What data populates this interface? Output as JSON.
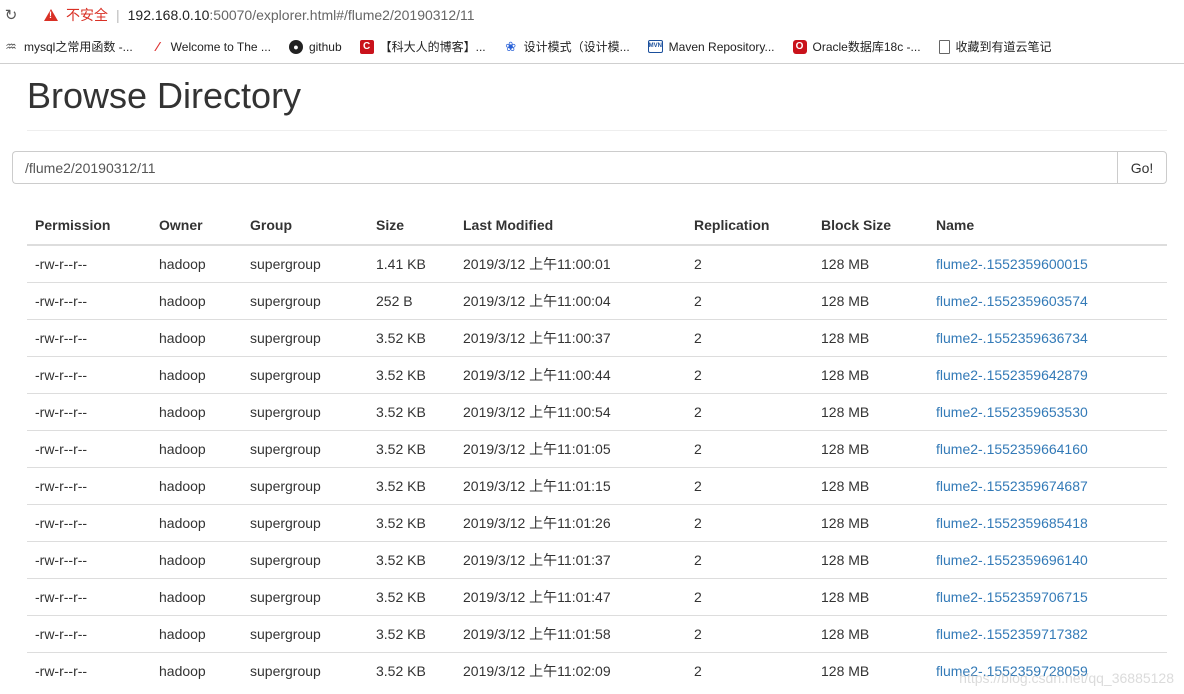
{
  "browser": {
    "security_label": "不安全",
    "url_host": "192.168.0.10",
    "url_rest": ":50070/explorer.html#/flume2/20190312/11",
    "bookmarks": [
      {
        "label": "mysql之常用函数 -...",
        "icon": "mysql-icon"
      },
      {
        "label": "Welcome to The ...",
        "icon": "feather-icon"
      },
      {
        "label": "github",
        "icon": "github-icon"
      },
      {
        "label": "【科大人的博客】...",
        "icon": "csdn-icon"
      },
      {
        "label": "设计模式（设计模...",
        "icon": "baidu-icon"
      },
      {
        "label": "Maven Repository...",
        "icon": "mvn-icon"
      },
      {
        "label": "Oracle数据库18c -...",
        "icon": "oracle-icon"
      },
      {
        "label": "收藏到有道云笔记",
        "icon": "page-icon"
      }
    ]
  },
  "page": {
    "title": "Browse Directory",
    "path_value": "/flume2/20190312/11",
    "go_label": "Go!"
  },
  "table": {
    "headers": [
      "Permission",
      "Owner",
      "Group",
      "Size",
      "Last Modified",
      "Replication",
      "Block Size",
      "Name"
    ],
    "rows": [
      [
        "-rw-r--r--",
        "hadoop",
        "supergroup",
        "1.41 KB",
        "2019/3/12 上午11:00:01",
        "2",
        "128 MB",
        "flume2-.1552359600015"
      ],
      [
        "-rw-r--r--",
        "hadoop",
        "supergroup",
        "252 B",
        "2019/3/12 上午11:00:04",
        "2",
        "128 MB",
        "flume2-.1552359603574"
      ],
      [
        "-rw-r--r--",
        "hadoop",
        "supergroup",
        "3.52 KB",
        "2019/3/12 上午11:00:37",
        "2",
        "128 MB",
        "flume2-.1552359636734"
      ],
      [
        "-rw-r--r--",
        "hadoop",
        "supergroup",
        "3.52 KB",
        "2019/3/12 上午11:00:44",
        "2",
        "128 MB",
        "flume2-.1552359642879"
      ],
      [
        "-rw-r--r--",
        "hadoop",
        "supergroup",
        "3.52 KB",
        "2019/3/12 上午11:00:54",
        "2",
        "128 MB",
        "flume2-.1552359653530"
      ],
      [
        "-rw-r--r--",
        "hadoop",
        "supergroup",
        "3.52 KB",
        "2019/3/12 上午11:01:05",
        "2",
        "128 MB",
        "flume2-.1552359664160"
      ],
      [
        "-rw-r--r--",
        "hadoop",
        "supergroup",
        "3.52 KB",
        "2019/3/12 上午11:01:15",
        "2",
        "128 MB",
        "flume2-.1552359674687"
      ],
      [
        "-rw-r--r--",
        "hadoop",
        "supergroup",
        "3.52 KB",
        "2019/3/12 上午11:01:26",
        "2",
        "128 MB",
        "flume2-.1552359685418"
      ],
      [
        "-rw-r--r--",
        "hadoop",
        "supergroup",
        "3.52 KB",
        "2019/3/12 上午11:01:37",
        "2",
        "128 MB",
        "flume2-.1552359696140"
      ],
      [
        "-rw-r--r--",
        "hadoop",
        "supergroup",
        "3.52 KB",
        "2019/3/12 上午11:01:47",
        "2",
        "128 MB",
        "flume2-.1552359706715"
      ],
      [
        "-rw-r--r--",
        "hadoop",
        "supergroup",
        "3.52 KB",
        "2019/3/12 上午11:01:58",
        "2",
        "128 MB",
        "flume2-.1552359717382"
      ],
      [
        "-rw-r--r--",
        "hadoop",
        "supergroup",
        "3.52 KB",
        "2019/3/12 上午11:02:09",
        "2",
        "128 MB",
        "flume2-.1552359728059"
      ]
    ]
  },
  "watermark": "https://blog.csdn.net/qq_36885128",
  "colors": {
    "link": "#337ab7",
    "insecure": "#d93025"
  }
}
